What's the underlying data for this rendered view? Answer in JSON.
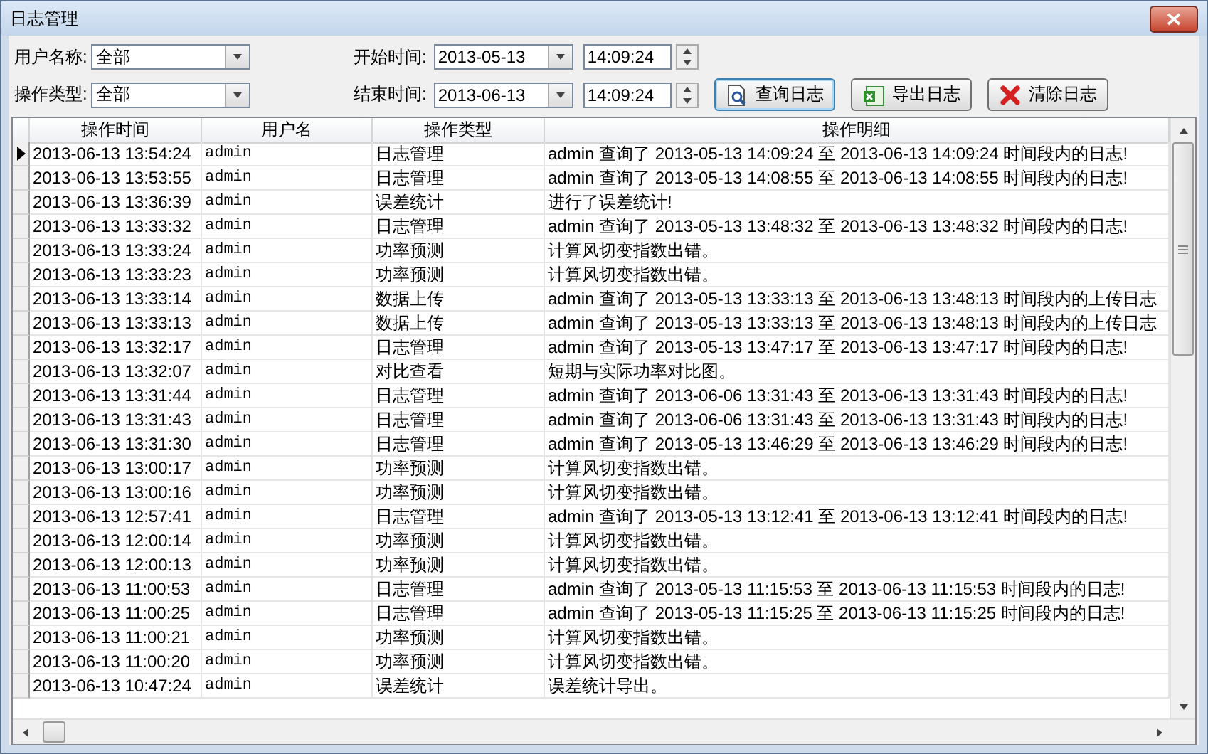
{
  "window": {
    "title": "日志管理"
  },
  "filters": [
    {
      "kind": "combo",
      "label": "用户名称:",
      "value": "全部",
      "time_label": "开始时间:",
      "date": "2013-05-13",
      "time": "14:09:24"
    },
    {
      "kind": "combo",
      "label": "操作类型:",
      "value": "全部",
      "time_label": "结束时间:",
      "date": "2013-06-13",
      "time": "14:09:24"
    }
  ],
  "buttons": [
    {
      "kind": "query",
      "label": "查询日志",
      "selected": true
    },
    {
      "kind": "export",
      "label": "导出日志",
      "selected": false
    },
    {
      "kind": "clear",
      "label": "清除日志",
      "selected": false
    }
  ],
  "table": {
    "columns": [
      "操作时间",
      "用户名",
      "操作类型",
      "操作明细"
    ],
    "rows": [
      {
        "selected": true,
        "cells": [
          "2013-06-13 13:54:24",
          "admin",
          "日志管理",
          "admin 查询了 2013-05-13 14:09:24 至 2013-06-13 14:09:24 时间段内的日志!"
        ]
      },
      {
        "selected": false,
        "cells": [
          "2013-06-13 13:53:55",
          "admin",
          "日志管理",
          "admin 查询了 2013-05-13 14:08:55 至 2013-06-13 14:08:55 时间段内的日志!"
        ]
      },
      {
        "selected": false,
        "cells": [
          "2013-06-13 13:36:39",
          "admin",
          "误差统计",
          "进行了误差统计!"
        ]
      },
      {
        "selected": false,
        "cells": [
          "2013-06-13 13:33:32",
          "admin",
          "日志管理",
          "admin 查询了 2013-05-13 13:48:32 至 2013-06-13 13:48:32 时间段内的日志!"
        ]
      },
      {
        "selected": false,
        "cells": [
          "2013-06-13 13:33:24",
          "admin",
          "功率预测",
          "计算风切变指数出错。"
        ]
      },
      {
        "selected": false,
        "cells": [
          "2013-06-13 13:33:23",
          "admin",
          "功率预测",
          "计算风切变指数出错。"
        ]
      },
      {
        "selected": false,
        "cells": [
          "2013-06-13 13:33:14",
          "admin",
          "数据上传",
          "admin 查询了 2013-05-13 13:33:13 至 2013-06-13 13:48:13 时间段内的上传日志"
        ]
      },
      {
        "selected": false,
        "cells": [
          "2013-06-13 13:33:13",
          "admin",
          "数据上传",
          "admin 查询了 2013-05-13 13:33:13 至 2013-06-13 13:48:13 时间段内的上传日志"
        ]
      },
      {
        "selected": false,
        "cells": [
          "2013-06-13 13:32:17",
          "admin",
          "日志管理",
          "admin 查询了 2013-05-13 13:47:17 至 2013-06-13 13:47:17 时间段内的日志!"
        ]
      },
      {
        "selected": false,
        "cells": [
          "2013-06-13 13:32:07",
          "admin",
          "对比查看",
          "短期与实际功率对比图。"
        ]
      },
      {
        "selected": false,
        "cells": [
          "2013-06-13 13:31:44",
          "admin",
          "日志管理",
          "admin 查询了 2013-06-06 13:31:43 至 2013-06-13 13:31:43 时间段内的日志!"
        ]
      },
      {
        "selected": false,
        "cells": [
          "2013-06-13 13:31:43",
          "admin",
          "日志管理",
          "admin 查询了 2013-06-06 13:31:43 至 2013-06-13 13:31:43 时间段内的日志!"
        ]
      },
      {
        "selected": false,
        "cells": [
          "2013-06-13 13:31:30",
          "admin",
          "日志管理",
          "admin 查询了 2013-05-13 13:46:29 至 2013-06-13 13:46:29 时间段内的日志!"
        ]
      },
      {
        "selected": false,
        "cells": [
          "2013-06-13 13:00:17",
          "admin",
          "功率预测",
          "计算风切变指数出错。"
        ]
      },
      {
        "selected": false,
        "cells": [
          "2013-06-13 13:00:16",
          "admin",
          "功率预测",
          "计算风切变指数出错。"
        ]
      },
      {
        "selected": false,
        "cells": [
          "2013-06-13 12:57:41",
          "admin",
          "日志管理",
          "admin 查询了 2013-05-13 13:12:41 至 2013-06-13 13:12:41 时间段内的日志!"
        ]
      },
      {
        "selected": false,
        "cells": [
          "2013-06-13 12:00:14",
          "admin",
          "功率预测",
          "计算风切变指数出错。"
        ]
      },
      {
        "selected": false,
        "cells": [
          "2013-06-13 12:00:13",
          "admin",
          "功率预测",
          "计算风切变指数出错。"
        ]
      },
      {
        "selected": false,
        "cells": [
          "2013-06-13 11:00:53",
          "admin",
          "日志管理",
          "admin 查询了 2013-05-13 11:15:53 至 2013-06-13 11:15:53 时间段内的日志!"
        ]
      },
      {
        "selected": false,
        "cells": [
          "2013-06-13 11:00:25",
          "admin",
          "日志管理",
          "admin 查询了 2013-05-13 11:15:25 至 2013-06-13 11:15:25 时间段内的日志!"
        ]
      },
      {
        "selected": false,
        "cells": [
          "2013-06-13 11:00:21",
          "admin",
          "功率预测",
          "计算风切变指数出错。"
        ]
      },
      {
        "selected": false,
        "cells": [
          "2013-06-13 11:00:20",
          "admin",
          "功率预测",
          "计算风切变指数出错。"
        ]
      },
      {
        "selected": false,
        "cells": [
          "2013-06-13 10:47:24",
          "admin",
          "误差统计",
          "误差统计导出。"
        ]
      }
    ]
  }
}
